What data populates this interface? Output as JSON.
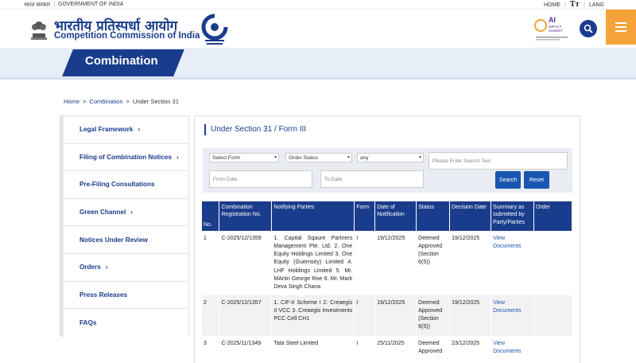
{
  "topbar": {
    "hindi_label": "भारत सरकार",
    "gov_label": "GOVERNMENT OF INDIA",
    "home": "HOME",
    "text_size": "Tт",
    "lang": "LANG"
  },
  "header": {
    "title_hindi": "भारतीय प्रतिस्पर्धा आयोग",
    "title_english": "Competition Commission of India",
    "ai_badge": [
      "AI",
      "IMPACT",
      "SUMMIT"
    ],
    "icons": [
      "national-emblem",
      "cci-logo",
      "search-icon",
      "menu-icon"
    ],
    "accent_color": "#f5a23a",
    "brand_color": "#1a3c8c"
  },
  "banner": {
    "title": "Combination"
  },
  "breadcrumb": {
    "home": "Home",
    "combination": "Combination",
    "current": "Under Section 31",
    "separator": ">"
  },
  "sidebar": {
    "items": [
      {
        "label": "Legal Framework",
        "chevron": "›"
      },
      {
        "label": "Filing of Combination Notices",
        "chevron": "›"
      },
      {
        "label": "Pre-Filing Consultations",
        "chevron": ""
      },
      {
        "label": "Green Channel",
        "chevron": "›"
      },
      {
        "label": "Notices Under Review",
        "chevron": ""
      },
      {
        "label": "Orders",
        "chevron": "›"
      },
      {
        "label": "Press Releases",
        "chevron": ""
      },
      {
        "label": "FAQs",
        "chevron": ""
      }
    ]
  },
  "main": {
    "title": "Under Section 31 / Form III",
    "filters": {
      "select_form": "Select Form",
      "order_status": "Order Status",
      "any": "any",
      "search_placeholder": "Please Enter Search Text",
      "from_date": "From Date",
      "to_date": "To Date",
      "search_button": "Search",
      "reset_button": "Reset"
    },
    "table": {
      "headers": {
        "no": "No.",
        "reg": "Combination Registration No.",
        "parties": "Notifying Parties",
        "form": "Form",
        "date_notification": "Date of Notification",
        "status": "Status",
        "decision_date": "Decision Date",
        "summary": "Summary as submitted by Party/Parties",
        "order": "Order"
      },
      "rows": [
        {
          "no": "1",
          "reg": "C-2025/12/1359",
          "parties": "1. Capital Sqaure Partners Management Pte. Ltd. 2. One Equity Holdings Limited 3. One Equity (Guernsey) Limited 4. LHF Holdings Limited 5. Mr. MArtin George Roe 6. Mr. Mark Deva Singh Chana",
          "form": "I",
          "date": "19/12/2025",
          "status": "Deemed Approved (Section 6(5))",
          "decision": "19/12/2025",
          "summary": "View Documents",
          "order": ""
        },
        {
          "no": "2",
          "reg": "C-2025/12/1357",
          "parties": "1. CIF-II Scheme I 2. Creaegis II VCC 3. Creaegis Investments PCC Cell CH1",
          "form": "I",
          "date": "19/12/2025",
          "status": "Deemed Approved (Section 6(5))",
          "decision": "19/12/2025",
          "summary": "View Documents",
          "order": ""
        },
        {
          "no": "3",
          "reg": "C-2025/11/1349",
          "parties": "Tata Steel Limited",
          "form": "I",
          "date": "25/11/2025",
          "status": "Deemed Approved",
          "decision": "23/12/2025",
          "summary": "View Documents",
          "order": ""
        }
      ]
    }
  }
}
